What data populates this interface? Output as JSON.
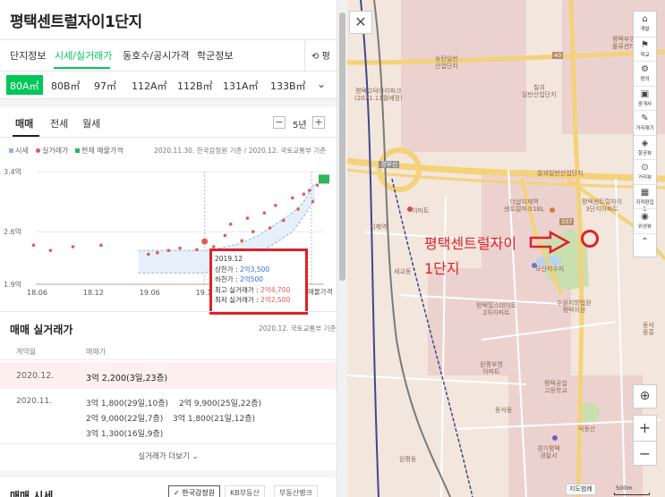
{
  "panel": {
    "title": "평택센트럴자이1단지",
    "tabs": [
      {
        "label": "단지정보",
        "active": false
      },
      {
        "label": "시세/실거래가",
        "active": true
      },
      {
        "label": "동호수/공시가격",
        "active": false
      },
      {
        "label": "학군정보",
        "active": false
      }
    ],
    "tab_right_label": "평",
    "areas": [
      {
        "label": "80A㎡",
        "active": true
      },
      {
        "label": "80B㎡",
        "active": false
      },
      {
        "label": "97㎡",
        "active": false
      },
      {
        "label": "112A㎡",
        "active": false
      },
      {
        "label": "112B㎡",
        "active": false
      },
      {
        "label": "131A㎡",
        "active": false
      },
      {
        "label": "133B㎡",
        "active": false
      }
    ],
    "subtabs": [
      {
        "label": "매매",
        "active": true
      },
      {
        "label": "전세",
        "active": false
      },
      {
        "label": "월세",
        "active": false
      }
    ],
    "period": {
      "minus": "−",
      "value": "5년",
      "plus": "+"
    },
    "legend": [
      {
        "label": "시세",
        "color": "#8fb4e3"
      },
      {
        "label": "실거래가",
        "color": "#e35a5a"
      },
      {
        "label": "현재 매물가격",
        "color": "#2fb45a"
      }
    ],
    "legend_note": "2020.11.30. 한국감정원 기준 / 2020.12. 국토교통부 기준",
    "tooltip": {
      "date": "2019.12",
      "upper_label": "상한가 :",
      "upper_value": "2억3,500",
      "lower_label": "하한가 :",
      "lower_value": "2억500",
      "max_label": "최고 실거래가 :",
      "max_value": "2억4,700",
      "min_label": "최저 실거래가 :",
      "min_value": "2억2,500"
    },
    "chart_extra_label": "매물가격",
    "trades": {
      "title": "매매 실거래가",
      "note": "2020.12. 국토교통부 기준",
      "col_date": "계약월",
      "col_price": "매매가",
      "rows": [
        {
          "date": "2020.12.",
          "items": [
            "3억 2,200(3일,23층)"
          ]
        },
        {
          "date": "2020.11.",
          "items": [
            "3억 1,800(29일,10층)",
            "2억 9,900(25일,22층)",
            "2억 9,000(22일,7층)",
            "3억 1,800(21일,12층)",
            "3억 1,300(16일,9층)"
          ]
        }
      ],
      "more": "실거래가 더보기 ⌄"
    },
    "section2": {
      "title": "매매 시세",
      "sources": [
        "✓ 한국감정원",
        "KB부동산",
        "부동산뱅크"
      ]
    }
  },
  "chart_data": {
    "type": "scatter",
    "x_ticks": [
      "18.06",
      "18.12",
      "19.06",
      "19.12"
    ],
    "y_ticks": [
      "3.4억",
      "2.6억",
      "1.9억"
    ],
    "ylim": [
      1.9,
      3.4
    ],
    "series": [
      {
        "name": "시세",
        "type": "area",
        "color": "#8fb4e3",
        "x": [
          2019.33,
          2019.5,
          2019.75,
          2019.92,
          2020.0,
          2020.25,
          2020.4,
          2020.55,
          2020.7,
          2020.8,
          2020.9
        ],
        "upper": [
          2.35,
          2.35,
          2.35,
          2.35,
          2.36,
          2.45,
          2.55,
          2.7,
          2.85,
          3.0,
          3.25
        ],
        "lower": [
          2.05,
          2.05,
          2.05,
          2.05,
          2.08,
          2.2,
          2.32,
          2.45,
          2.6,
          2.8,
          3.05
        ]
      },
      {
        "name": "실거래가",
        "type": "scatter",
        "color": "#e35a5a",
        "x": [
          2018.4,
          2018.55,
          2018.75,
          2019.0,
          2019.42,
          2019.5,
          2019.6,
          2019.7,
          2019.85,
          2019.92,
          2020.0,
          2020.1,
          2020.15,
          2020.25,
          2020.3,
          2020.35,
          2020.45,
          2020.5,
          2020.55,
          2020.62,
          2020.7,
          2020.75,
          2020.8,
          2020.85,
          2020.88,
          2020.92
        ],
        "y": [
          2.42,
          2.35,
          2.4,
          2.42,
          2.3,
          2.32,
          2.35,
          2.38,
          2.36,
          2.47,
          2.4,
          2.55,
          2.7,
          2.48,
          2.78,
          2.6,
          2.85,
          2.65,
          2.95,
          2.75,
          3.05,
          2.9,
          3.1,
          3.15,
          3.0,
          3.22
        ]
      },
      {
        "name": "현재 매물가격",
        "type": "marker",
        "color": "#2fb45a",
        "x": [
          2021.0
        ],
        "y": [
          3.3
        ]
      }
    ]
  },
  "map": {
    "close_label": "✕",
    "annotation_text": "평택센트럴자이\n1단지",
    "annotation_color": "#e0202a",
    "labels": [
      {
        "text": "송탄일반\n산업단지",
        "kind": "place"
      },
      {
        "text": "평택고덕아이파크\n(2021.11월예정)",
        "kind": "place"
      },
      {
        "text": "칠괴\n일반산업단지",
        "kind": "place"
      },
      {
        "text": "칠괴일반산업단지",
        "kind": "place"
      },
      {
        "text": "이마트",
        "kind": "place"
      },
      {
        "text": "더샵지제역\n센트럴파크1BL",
        "kind": "place"
      },
      {
        "text": "평택센트럴자이\n3단지아파트",
        "kind": "place"
      },
      {
        "text": "모산저수지",
        "kind": "place"
      },
      {
        "text": "평택힐스테이트\n2차아파트",
        "kind": "place"
      },
      {
        "text": "수원지방법원\n평택지원",
        "kind": "place"
      },
      {
        "text": "원평부영\n아파트",
        "kind": "place"
      },
      {
        "text": "평택공업\n고등학교",
        "kind": "place"
      },
      {
        "text": "동삭동",
        "kind": "place"
      },
      {
        "text": "덕동산",
        "kind": "place"
      },
      {
        "text": "경기평택\n경찰서",
        "kind": "place"
      },
      {
        "text": "지제역",
        "kind": "place"
      },
      {
        "text": "세교동",
        "kind": "place"
      },
      {
        "text": "평택부영\n물류센터",
        "kind": "place"
      },
      {
        "text": "원평동",
        "kind": "place"
      },
      {
        "text": "동삭\n중흥",
        "kind": "place"
      },
      {
        "text": "40",
        "kind": "road"
      },
      {
        "text": "337",
        "kind": "road"
      },
      {
        "text": "경부선",
        "kind": "road"
      }
    ],
    "tools": [
      {
        "icon": "⌂",
        "label": "개발",
        "name": "dev-icon"
      },
      {
        "icon": "⚑",
        "label": "학교",
        "name": "school-icon"
      },
      {
        "icon": "⚙",
        "label": "편의",
        "name": "convenience-icon"
      },
      {
        "icon": "▣",
        "label": "중개사",
        "name": "agent-icon"
      },
      {
        "icon": "✎",
        "label": "거리재기",
        "name": "ruler-icon"
      },
      {
        "icon": "◈",
        "label": "항공뷰",
        "name": "aerial-icon"
      },
      {
        "icon": "⊙",
        "label": "거리뷰",
        "name": "street-icon"
      },
      {
        "icon": "▦",
        "label": "지적편집도",
        "name": "cadastral-icon"
      },
      {
        "icon": "◉",
        "label": "위성뷰",
        "name": "satellite-icon"
      },
      {
        "icon": "⌃",
        "label": "",
        "name": "collapse-icon"
      }
    ],
    "locate_icon": "⊕",
    "zoom_in": "+",
    "zoom_out": "−",
    "legend_button": "지도범례",
    "scale": "500m"
  }
}
